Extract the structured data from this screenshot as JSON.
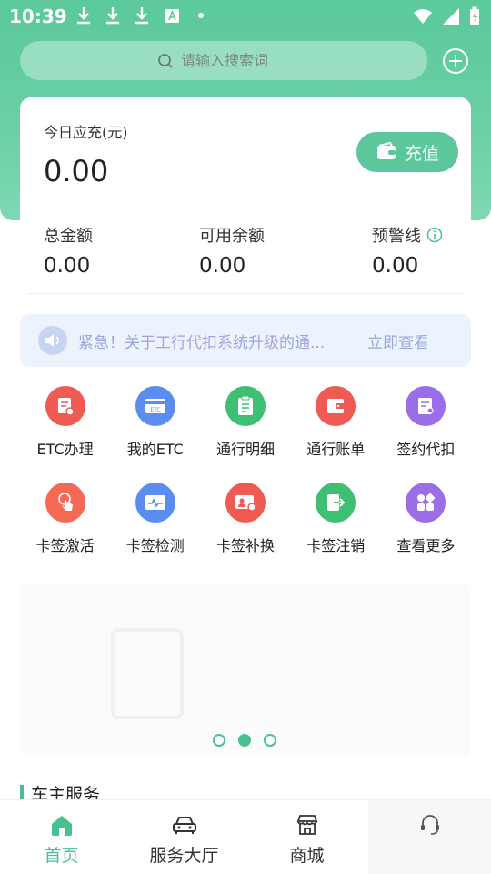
{
  "status_bar": {
    "time": "10:39"
  },
  "search": {
    "placeholder": "请输入搜索词"
  },
  "card": {
    "today_label": "今日应充(元)",
    "today_amount": "0.00",
    "recharge_label": "充值",
    "stats": [
      {
        "label": "总金额",
        "value": "0.00"
      },
      {
        "label": "可用余额",
        "value": "0.00"
      },
      {
        "label": "预警线",
        "value": "0.00"
      }
    ]
  },
  "notice": {
    "text": "紧急！关于工行代扣系统升级的通...",
    "link": "立即查看"
  },
  "grid": [
    {
      "label": "ETC办理",
      "icon": "etc-apply-icon",
      "color": "#ef5a52"
    },
    {
      "label": "我的ETC",
      "icon": "my-etc-icon",
      "color": "#5b8df0"
    },
    {
      "label": "通行明细",
      "icon": "pass-detail-icon",
      "color": "#3fbf73"
    },
    {
      "label": "通行账单",
      "icon": "pass-bill-icon",
      "color": "#ef5a52"
    },
    {
      "label": "签约代扣",
      "icon": "sign-deduct-icon",
      "color": "#9b6ee8"
    },
    {
      "label": "卡签激活",
      "icon": "card-activate-icon",
      "color": "#f46a55"
    },
    {
      "label": "卡签检测",
      "icon": "card-detect-icon",
      "color": "#5b8df0"
    },
    {
      "label": "卡签补换",
      "icon": "card-replace-icon",
      "color": "#ef5a52"
    },
    {
      "label": "卡签注销",
      "icon": "card-cancel-icon",
      "color": "#3fbf73"
    },
    {
      "label": "查看更多",
      "icon": "more-icon",
      "color": "#9b6ee8"
    }
  ],
  "banner": {
    "page_count": 3,
    "active_index": 1
  },
  "section": {
    "title": "车主服务"
  },
  "tabbar": [
    {
      "label": "首页",
      "icon": "home-icon",
      "active": true
    },
    {
      "label": "服务大厅",
      "icon": "car-icon",
      "active": false
    },
    {
      "label": "商城",
      "icon": "store-icon",
      "active": false
    },
    {
      "label": "",
      "icon": "customer-service-icon",
      "active": false
    }
  ],
  "colors": {
    "brand": "#5bc99a",
    "accent": "#49c08f",
    "notice_bg": "#edf3fd",
    "notice_text": "#9aa6da"
  }
}
